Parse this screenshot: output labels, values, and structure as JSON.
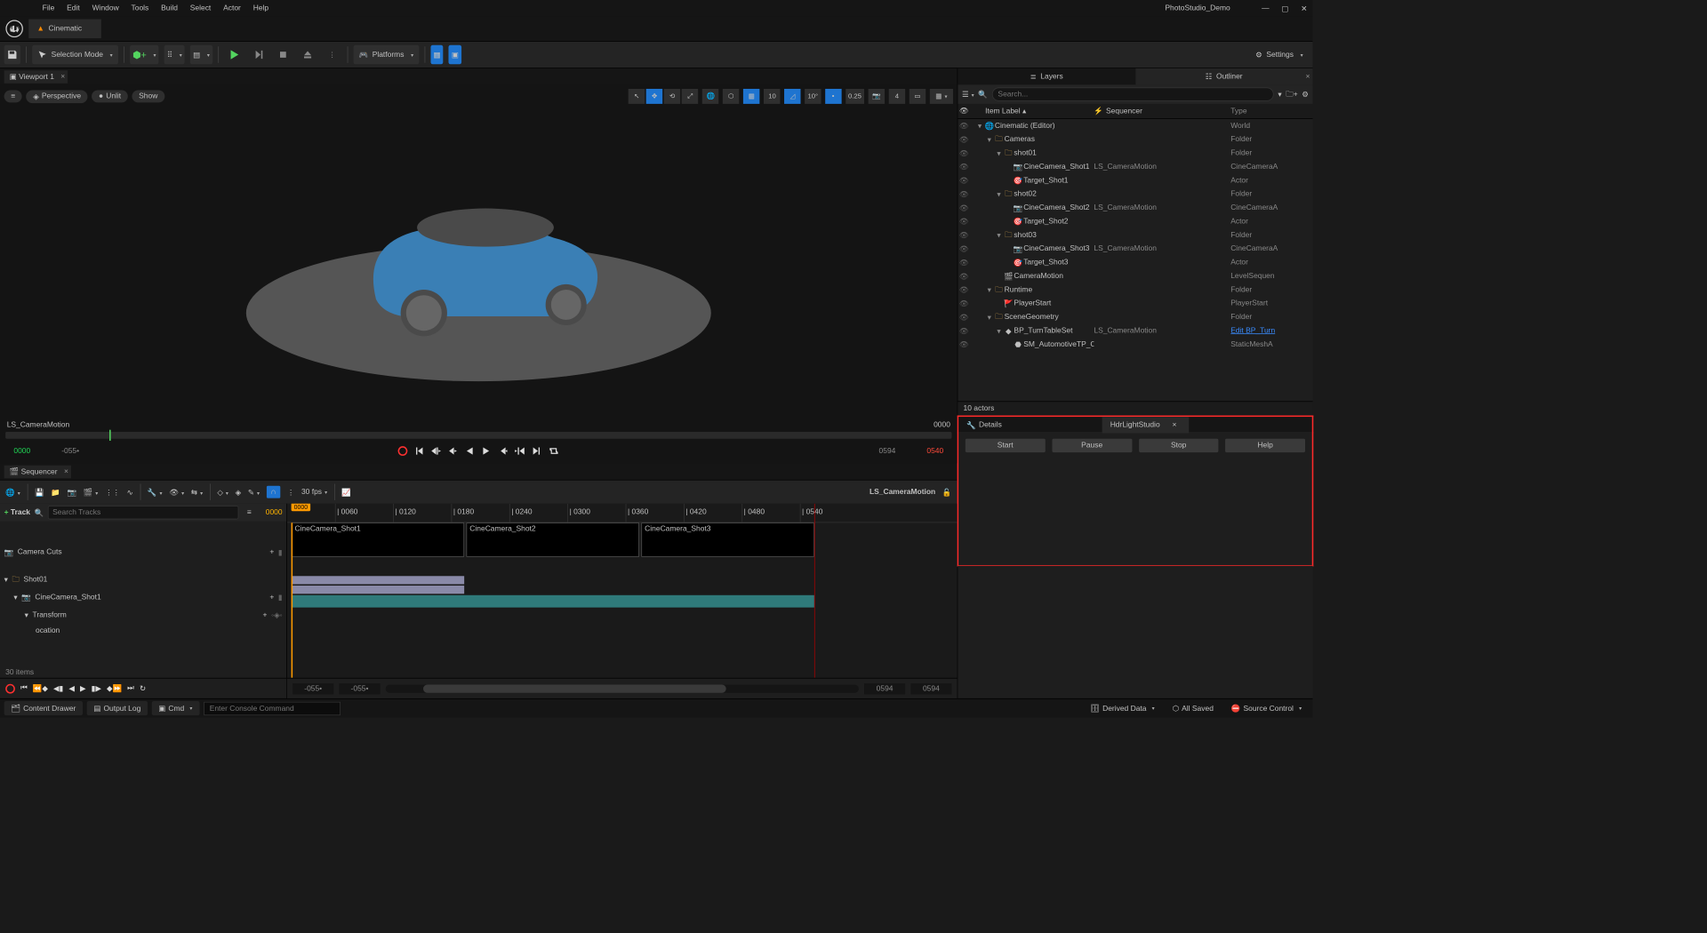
{
  "menu": {
    "file": "File",
    "edit": "Edit",
    "window": "Window",
    "tools": "Tools",
    "build": "Build",
    "select": "Select",
    "actor": "Actor",
    "help": "Help"
  },
  "project_name": "PhotoStudio_Demo",
  "main_tab": "Cinematic",
  "toolbar": {
    "selection_mode": "Selection Mode",
    "platforms": "Platforms",
    "settings": "Settings"
  },
  "viewport": {
    "tab": "Viewport 1",
    "perspective": "Perspective",
    "unlit": "Unlit",
    "show": "Show",
    "snap_grid": "10",
    "snap_angle": "10°",
    "snap_scale": "0.25",
    "camera_speed": "4",
    "footer_label": "LS_CameraMotion",
    "footer_frame": "0000",
    "tc_start": "0000",
    "tc_offset": "-055•",
    "tc_cur": "0594",
    "tc_end": "0540"
  },
  "sequencer": {
    "tab": "Sequencer",
    "fps": "30 fps",
    "title": "LS_CameraMotion",
    "add_track": "Track",
    "search_placeholder": "Search Tracks",
    "current_frame": "0000",
    "tracks": {
      "camera_cuts": "Camera Cuts",
      "shot01": "Shot01",
      "cine1": "CineCamera_Shot1",
      "transform": "Transform",
      "location": "ocation"
    },
    "items_count": "30 items",
    "ruler_start": "0000",
    "ticks": [
      "0060",
      "0120",
      "0180",
      "0240",
      "0300",
      "0360",
      "0420",
      "0480",
      "0540"
    ],
    "shots": [
      "CineCamera_Shot1",
      "CineCamera_Shot2",
      "CineCamera_Shot3"
    ],
    "range_out_l": "-055•",
    "range_in_l": "-055•",
    "range_in_r": "0594",
    "range_out_r": "0594"
  },
  "right": {
    "tab_layers": "Layers",
    "tab_outliner": "Outliner",
    "search_placeholder": "Search...",
    "header_item": "Item Label",
    "header_seq": "Sequencer",
    "header_type": "Type",
    "seq_binding": "LS_CameraMotion",
    "rows": [
      {
        "depth": 0,
        "exp": "▾",
        "icon": "world",
        "label": "Cinematic (Editor)",
        "seq": "",
        "type": "World"
      },
      {
        "depth": 1,
        "exp": "▾",
        "icon": "folder",
        "label": "Cameras",
        "seq": "",
        "type": "Folder"
      },
      {
        "depth": 2,
        "exp": "▾",
        "icon": "folder",
        "label": "shot01",
        "seq": "",
        "type": "Folder"
      },
      {
        "depth": 3,
        "exp": "",
        "icon": "cam",
        "label": "CineCamera_Shot1",
        "seq": "LS_CameraMotion",
        "type": "CineCameraA"
      },
      {
        "depth": 3,
        "exp": "",
        "icon": "target",
        "label": "Target_Shot1",
        "seq": "",
        "type": "Actor"
      },
      {
        "depth": 2,
        "exp": "▾",
        "icon": "folder",
        "label": "shot02",
        "seq": "",
        "type": "Folder"
      },
      {
        "depth": 3,
        "exp": "",
        "icon": "cam",
        "label": "CineCamera_Shot2",
        "seq": "LS_CameraMotion",
        "type": "CineCameraA"
      },
      {
        "depth": 3,
        "exp": "",
        "icon": "target",
        "label": "Target_Shot2",
        "seq": "",
        "type": "Actor"
      },
      {
        "depth": 2,
        "exp": "▾",
        "icon": "folder",
        "label": "shot03",
        "seq": "",
        "type": "Folder"
      },
      {
        "depth": 3,
        "exp": "",
        "icon": "cam",
        "label": "CineCamera_Shot3",
        "seq": "LS_CameraMotion",
        "type": "CineCameraA"
      },
      {
        "depth": 3,
        "exp": "",
        "icon": "target",
        "label": "Target_Shot3",
        "seq": "",
        "type": "Actor"
      },
      {
        "depth": 2,
        "exp": "",
        "icon": "clap",
        "label": "CameraMotion",
        "seq": "",
        "type": "LevelSequen"
      },
      {
        "depth": 1,
        "exp": "▾",
        "icon": "folder",
        "label": "Runtime",
        "seq": "",
        "type": "Folder"
      },
      {
        "depth": 2,
        "exp": "",
        "icon": "flag",
        "label": "PlayerStart",
        "seq": "",
        "type": "PlayerStart"
      },
      {
        "depth": 1,
        "exp": "▾",
        "icon": "folder",
        "label": "SceneGeometry",
        "seq": "",
        "type": "Folder"
      },
      {
        "depth": 2,
        "exp": "▾",
        "icon": "bp",
        "label": "BP_TurnTableSet",
        "seq": "LS_CameraMotion",
        "type": "Edit BP_Turn",
        "link": true
      },
      {
        "depth": 3,
        "exp": "",
        "icon": "mesh",
        "label": "SM_AutomotiveTP_C",
        "seq": "",
        "type": "StaticMeshA"
      }
    ],
    "actor_count": "10 actors",
    "details_tab": "Details",
    "hdr_tab": "HdrLightStudio",
    "hdr_buttons": {
      "start": "Start",
      "pause": "Pause",
      "stop": "Stop",
      "help": "Help"
    }
  },
  "status": {
    "content_drawer": "Content Drawer",
    "output_log": "Output Log",
    "cmd_label": "Cmd",
    "cmd_placeholder": "Enter Console Command",
    "derived": "Derived Data",
    "saved": "All Saved",
    "source_ctrl": "Source Control"
  }
}
